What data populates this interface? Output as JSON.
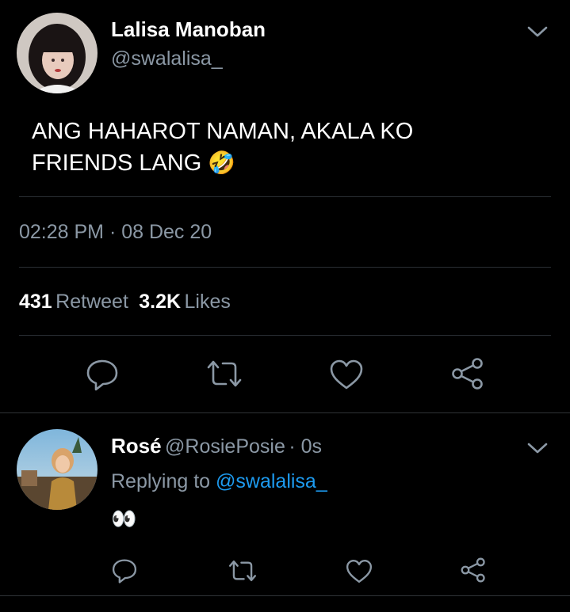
{
  "tweet": {
    "author_name": "Lalisa Manoban",
    "author_handle": "@swalalisa_",
    "text_line1": "ANG HAHAROT NAMAN, AKALA KO",
    "text_line2": "FRIENDS LANG",
    "emoji": "🤣",
    "timestamp": "02:28 PM · 08 Dec 20",
    "retweet_count": "431",
    "retweet_label": "Retweet",
    "like_count": "3.2K",
    "like_label": "Likes"
  },
  "reply": {
    "author_name": "Rosé",
    "author_handle": "@RosiePosie",
    "time": "· 0s",
    "replying_to_label": "Replying to",
    "replying_to_handle": "@swalalisa_",
    "text": "👀"
  },
  "icons": [
    "chevron-down-icon",
    "reply-icon",
    "retweet-icon",
    "like-icon",
    "share-icon"
  ],
  "colors": {
    "background": "#000000",
    "muted": "#8b98a5",
    "link": "#1d9bf0",
    "divider": "#2f3336"
  }
}
